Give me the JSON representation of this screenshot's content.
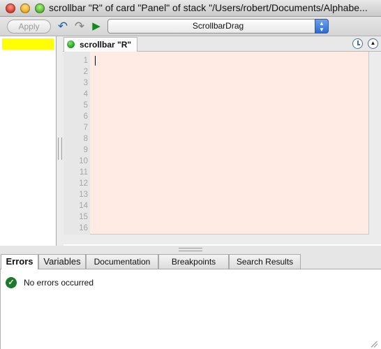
{
  "window": {
    "title": "scrollbar \"R\" of card \"Panel\" of stack \"/Users/robert/Documents/Alphabe..."
  },
  "toolbar": {
    "apply_label": "Apply",
    "undo_icon": "undo-icon",
    "redo_icon": "redo-icon",
    "run_icon": "run-icon",
    "handler_selected": "ScrollbarDrag"
  },
  "editor": {
    "tab_label": "scrollbar \"R\"",
    "line_numbers": [
      "1",
      "2",
      "3",
      "4",
      "5",
      "6",
      "7",
      "8",
      "9",
      "10",
      "11",
      "12",
      "13",
      "14",
      "15",
      "16"
    ],
    "background_color": "#ffebe4"
  },
  "sidebar": {
    "highlight_color": "#ffff00"
  },
  "bottom_tabs": [
    {
      "label": "Errors",
      "active": true
    },
    {
      "label": "Variables",
      "active": false
    },
    {
      "label": "Documentation",
      "active": false
    },
    {
      "label": "Breakpoints",
      "active": false
    },
    {
      "label": "Search Results",
      "active": false
    }
  ],
  "errors_panel": {
    "status_icon": "check-circle-icon",
    "message": "No errors occurred"
  }
}
